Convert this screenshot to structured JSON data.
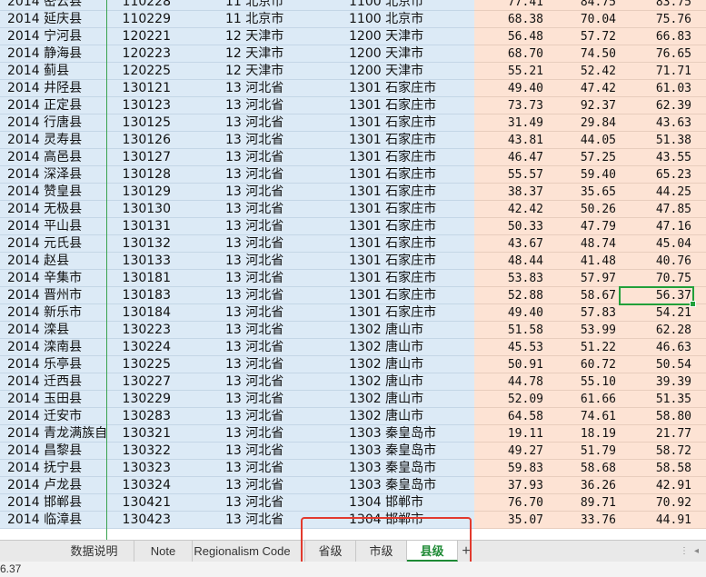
{
  "rows": [
    {
      "year": "2014",
      "county": "密云县",
      "code": "110228",
      "prov_code": "11",
      "prov": "北京市",
      "city_code": "1100",
      "city": "北京市",
      "v1": "77.41",
      "v2": "84.75",
      "v3": "83.75"
    },
    {
      "year": "2014",
      "county": "延庆县",
      "code": "110229",
      "prov_code": "11",
      "prov": "北京市",
      "city_code": "1100",
      "city": "北京市",
      "v1": "68.38",
      "v2": "70.04",
      "v3": "75.76"
    },
    {
      "year": "2014",
      "county": "宁河县",
      "code": "120221",
      "prov_code": "12",
      "prov": "天津市",
      "city_code": "1200",
      "city": "天津市",
      "v1": "56.48",
      "v2": "57.72",
      "v3": "66.83"
    },
    {
      "year": "2014",
      "county": "静海县",
      "code": "120223",
      "prov_code": "12",
      "prov": "天津市",
      "city_code": "1200",
      "city": "天津市",
      "v1": "68.70",
      "v2": "74.50",
      "v3": "76.65"
    },
    {
      "year": "2014",
      "county": "蓟县",
      "code": "120225",
      "prov_code": "12",
      "prov": "天津市",
      "city_code": "1200",
      "city": "天津市",
      "v1": "55.21",
      "v2": "52.42",
      "v3": "71.71"
    },
    {
      "year": "2014",
      "county": "井陉县",
      "code": "130121",
      "prov_code": "13",
      "prov": "河北省",
      "city_code": "1301",
      "city": "石家庄市",
      "v1": "49.40",
      "v2": "47.42",
      "v3": "61.03"
    },
    {
      "year": "2014",
      "county": "正定县",
      "code": "130123",
      "prov_code": "13",
      "prov": "河北省",
      "city_code": "1301",
      "city": "石家庄市",
      "v1": "73.73",
      "v2": "92.37",
      "v3": "62.39"
    },
    {
      "year": "2014",
      "county": "行唐县",
      "code": "130125",
      "prov_code": "13",
      "prov": "河北省",
      "city_code": "1301",
      "city": "石家庄市",
      "v1": "31.49",
      "v2": "29.84",
      "v3": "43.63"
    },
    {
      "year": "2014",
      "county": "灵寿县",
      "code": "130126",
      "prov_code": "13",
      "prov": "河北省",
      "city_code": "1301",
      "city": "石家庄市",
      "v1": "43.81",
      "v2": "44.05",
      "v3": "51.38"
    },
    {
      "year": "2014",
      "county": "高邑县",
      "code": "130127",
      "prov_code": "13",
      "prov": "河北省",
      "city_code": "1301",
      "city": "石家庄市",
      "v1": "46.47",
      "v2": "57.25",
      "v3": "43.55"
    },
    {
      "year": "2014",
      "county": "深泽县",
      "code": "130128",
      "prov_code": "13",
      "prov": "河北省",
      "city_code": "1301",
      "city": "石家庄市",
      "v1": "55.57",
      "v2": "59.40",
      "v3": "65.23"
    },
    {
      "year": "2014",
      "county": "赞皇县",
      "code": "130129",
      "prov_code": "13",
      "prov": "河北省",
      "city_code": "1301",
      "city": "石家庄市",
      "v1": "38.37",
      "v2": "35.65",
      "v3": "44.25"
    },
    {
      "year": "2014",
      "county": "无极县",
      "code": "130130",
      "prov_code": "13",
      "prov": "河北省",
      "city_code": "1301",
      "city": "石家庄市",
      "v1": "42.42",
      "v2": "50.26",
      "v3": "47.85"
    },
    {
      "year": "2014",
      "county": "平山县",
      "code": "130131",
      "prov_code": "13",
      "prov": "河北省",
      "city_code": "1301",
      "city": "石家庄市",
      "v1": "50.33",
      "v2": "47.79",
      "v3": "47.16"
    },
    {
      "year": "2014",
      "county": "元氏县",
      "code": "130132",
      "prov_code": "13",
      "prov": "河北省",
      "city_code": "1301",
      "city": "石家庄市",
      "v1": "43.67",
      "v2": "48.74",
      "v3": "45.04"
    },
    {
      "year": "2014",
      "county": "赵县",
      "code": "130133",
      "prov_code": "13",
      "prov": "河北省",
      "city_code": "1301",
      "city": "石家庄市",
      "v1": "48.44",
      "v2": "41.48",
      "v3": "40.76"
    },
    {
      "year": "2014",
      "county": "辛集市",
      "code": "130181",
      "prov_code": "13",
      "prov": "河北省",
      "city_code": "1301",
      "city": "石家庄市",
      "v1": "53.83",
      "v2": "57.97",
      "v3": "70.75"
    },
    {
      "year": "2014",
      "county": "晋州市",
      "code": "130183",
      "prov_code": "13",
      "prov": "河北省",
      "city_code": "1301",
      "city": "石家庄市",
      "v1": "52.88",
      "v2": "58.67",
      "v3": "56.37"
    },
    {
      "year": "2014",
      "county": "新乐市",
      "code": "130184",
      "prov_code": "13",
      "prov": "河北省",
      "city_code": "1301",
      "city": "石家庄市",
      "v1": "49.40",
      "v2": "57.83",
      "v3": "54.21"
    },
    {
      "year": "2014",
      "county": "滦县",
      "code": "130223",
      "prov_code": "13",
      "prov": "河北省",
      "city_code": "1302",
      "city": "唐山市",
      "v1": "51.58",
      "v2": "53.99",
      "v3": "62.28"
    },
    {
      "year": "2014",
      "county": "滦南县",
      "code": "130224",
      "prov_code": "13",
      "prov": "河北省",
      "city_code": "1302",
      "city": "唐山市",
      "v1": "45.53",
      "v2": "51.22",
      "v3": "46.63"
    },
    {
      "year": "2014",
      "county": "乐亭县",
      "code": "130225",
      "prov_code": "13",
      "prov": "河北省",
      "city_code": "1302",
      "city": "唐山市",
      "v1": "50.91",
      "v2": "60.72",
      "v3": "50.54"
    },
    {
      "year": "2014",
      "county": "迁西县",
      "code": "130227",
      "prov_code": "13",
      "prov": "河北省",
      "city_code": "1302",
      "city": "唐山市",
      "v1": "44.78",
      "v2": "55.10",
      "v3": "39.39"
    },
    {
      "year": "2014",
      "county": "玉田县",
      "code": "130229",
      "prov_code": "13",
      "prov": "河北省",
      "city_code": "1302",
      "city": "唐山市",
      "v1": "52.09",
      "v2": "61.66",
      "v3": "51.35"
    },
    {
      "year": "2014",
      "county": "迁安市",
      "code": "130283",
      "prov_code": "13",
      "prov": "河北省",
      "city_code": "1302",
      "city": "唐山市",
      "v1": "64.58",
      "v2": "74.61",
      "v3": "58.80"
    },
    {
      "year": "2014",
      "county": "青龙满族自",
      "code": "130321",
      "prov_code": "13",
      "prov": "河北省",
      "city_code": "1303",
      "city": "秦皇岛市",
      "v1": "19.11",
      "v2": "18.19",
      "v3": "21.77"
    },
    {
      "year": "2014",
      "county": "昌黎县",
      "code": "130322",
      "prov_code": "13",
      "prov": "河北省",
      "city_code": "1303",
      "city": "秦皇岛市",
      "v1": "49.27",
      "v2": "51.79",
      "v3": "58.72"
    },
    {
      "year": "2014",
      "county": "抚宁县",
      "code": "130323",
      "prov_code": "13",
      "prov": "河北省",
      "city_code": "1303",
      "city": "秦皇岛市",
      "v1": "59.83",
      "v2": "58.68",
      "v3": "58.58"
    },
    {
      "year": "2014",
      "county": "卢龙县",
      "code": "130324",
      "prov_code": "13",
      "prov": "河北省",
      "city_code": "1303",
      "city": "秦皇岛市",
      "v1": "37.93",
      "v2": "36.26",
      "v3": "42.91"
    },
    {
      "year": "2014",
      "county": "邯郸县",
      "code": "130421",
      "prov_code": "13",
      "prov": "河北省",
      "city_code": "1304",
      "city": "邯郸市",
      "v1": "76.70",
      "v2": "89.71",
      "v3": "70.92"
    },
    {
      "year": "2014",
      "county": "临漳县",
      "code": "130423",
      "prov_code": "13",
      "prov": "河北省",
      "city_code": "1304",
      "city": "邯郸市",
      "v1": "35.07",
      "v2": "33.76",
      "v3": "44.91"
    }
  ],
  "selected_row": 17,
  "tabs": [
    {
      "label": "数据说明",
      "active": false
    },
    {
      "label": "Note",
      "active": false
    },
    {
      "label": "Regionalism Code",
      "active": false
    },
    {
      "label": "省级",
      "active": false
    },
    {
      "label": "市级",
      "active": false
    },
    {
      "label": "县级",
      "active": true
    }
  ],
  "add_tab_label": "+",
  "status": {
    "text": "6.37"
  },
  "colors": {
    "accent_green": "#22a03a",
    "highlight_red": "#e23a2e",
    "blue_fill": "#dceaf6",
    "peach_fill": "#fde3d4"
  }
}
